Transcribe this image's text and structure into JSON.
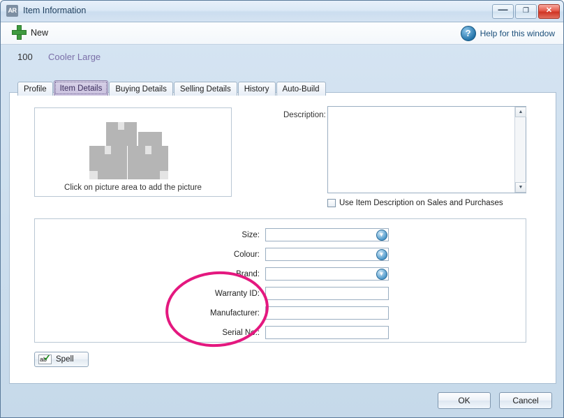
{
  "window": {
    "icon_text": "AR",
    "title": "Item Information",
    "buttons": {
      "minimize": "—",
      "maximize": "❐",
      "close": "✕"
    }
  },
  "toolbar": {
    "new_label": "New",
    "help_label": "Help for this window",
    "help_icon_text": "?"
  },
  "record": {
    "number": "100",
    "name": "Cooler Large"
  },
  "tabs": [
    {
      "label": "Profile",
      "active": false
    },
    {
      "label": "Item Details",
      "active": true
    },
    {
      "label": "Buying Details",
      "active": false
    },
    {
      "label": "Selling Details",
      "active": false
    },
    {
      "label": "History",
      "active": false
    },
    {
      "label": "Auto-Build",
      "active": false
    }
  ],
  "picture": {
    "caption": "Click on picture area to add the picture"
  },
  "description": {
    "label": "Description:",
    "value": "",
    "scroll_up": "▲",
    "scroll_down": "▼"
  },
  "checkbox": {
    "label": "Use Item Description on Sales and Purchases",
    "checked": false
  },
  "fields": [
    {
      "label": "Size:",
      "value": "",
      "type": "combo"
    },
    {
      "label": "Colour:",
      "value": "",
      "type": "combo"
    },
    {
      "label": "Brand:",
      "value": "",
      "type": "combo"
    },
    {
      "label": "Warranty ID:",
      "value": "",
      "type": "text"
    },
    {
      "label": "Manufacturer:",
      "value": "",
      "type": "text"
    },
    {
      "label": "Serial No.:",
      "value": "",
      "type": "text"
    }
  ],
  "combo_glyph": "▼",
  "spell": {
    "label": "Spell",
    "icon_text": "ab"
  },
  "footer": {
    "ok_label": "OK",
    "cancel_label": "Cancel"
  },
  "annotation": {
    "color": "#e4187f"
  }
}
